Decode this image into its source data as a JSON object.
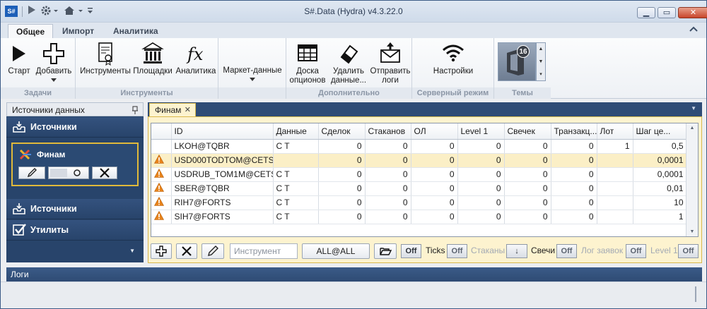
{
  "window": {
    "title": "S#.Data (Hydra) v4.3.22.0",
    "logo_text": "S#",
    "controls": {
      "minimize": "▁",
      "maximize": "▭",
      "close": "✕"
    }
  },
  "ribbon": {
    "tabs": [
      "Общее",
      "Импорт",
      "Аналитика"
    ],
    "active_tab": "Общее",
    "groups": [
      {
        "label": "Задачи",
        "buttons": [
          "Старт",
          "Добавить"
        ]
      },
      {
        "label": "Инструменты",
        "buttons": [
          "Инструменты",
          "Площадки",
          "Аналитика"
        ]
      },
      {
        "label": "",
        "buttons": [
          "Маркет-данные"
        ]
      },
      {
        "label": "Дополнительно",
        "buttons": [
          "Доска\nопционов",
          "Удалить\nданные...",
          "Отправить\nлоги"
        ]
      },
      {
        "label": "Серверный режим",
        "buttons": [
          "Настройки"
        ]
      },
      {
        "label": "Темы",
        "buttons": []
      }
    ],
    "theme_badge": "16"
  },
  "sidebar": {
    "title": "Источники данных",
    "sections": [
      "Источники",
      "Источники",
      "Утилиты"
    ],
    "card_name": "Финам"
  },
  "document": {
    "tab": "Финам",
    "columns": [
      "ID",
      "Данные",
      "Сделок",
      "Стаканов",
      "ОЛ",
      "Level 1",
      "Свечек",
      "Транзакц...",
      "Лот",
      "Шаг це..."
    ],
    "rows": [
      {
        "warn": false,
        "id": "LKOH@TQBR",
        "data": "C T",
        "trades": "0",
        "depths": "0",
        "ol": "0",
        "level1": "0",
        "candles": "0",
        "tx": "0",
        "lot": "1",
        "step": "0,5"
      },
      {
        "warn": true,
        "id": "USD000TODTOM@CETS",
        "data": "",
        "trades": "0",
        "depths": "0",
        "ol": "0",
        "level1": "0",
        "candles": "0",
        "tx": "0",
        "lot": "",
        "step": "0,0001"
      },
      {
        "warn": true,
        "id": "USDRUB_TOM1M@CETS",
        "data": "C T",
        "trades": "0",
        "depths": "0",
        "ol": "0",
        "level1": "0",
        "candles": "0",
        "tx": "0",
        "lot": "",
        "step": "0,0001"
      },
      {
        "warn": true,
        "id": "SBER@TQBR",
        "data": "C T",
        "trades": "0",
        "depths": "0",
        "ol": "0",
        "level1": "0",
        "candles": "0",
        "tx": "0",
        "lot": "",
        "step": "0,01"
      },
      {
        "warn": true,
        "id": "RIH7@FORTS",
        "data": "C T",
        "trades": "0",
        "depths": "0",
        "ol": "0",
        "level1": "0",
        "candles": "0",
        "tx": "0",
        "lot": "",
        "step": "10"
      },
      {
        "warn": true,
        "id": "SIH7@FORTS",
        "data": "C T",
        "trades": "0",
        "depths": "0",
        "ol": "0",
        "level1": "0",
        "candles": "0",
        "tx": "0",
        "lot": "",
        "step": "1"
      }
    ]
  },
  "toolbar": {
    "instrument_placeholder": "Инструмент",
    "all_label": "ALL@ALL",
    "toggle_off": "Off",
    "ticks_label": "Ticks",
    "depths_label": "Стаканы",
    "candles_label": "Свечи",
    "orderlog_label": "Лог заявок",
    "level1_label": "Level 1",
    "candles_dropdown": "↓"
  },
  "logs": {
    "title": "Логи"
  },
  "colors": {
    "accent_gold": "#e0b93a",
    "sidebar_blue": "#28446b",
    "selected_row": "#fbefc6"
  }
}
